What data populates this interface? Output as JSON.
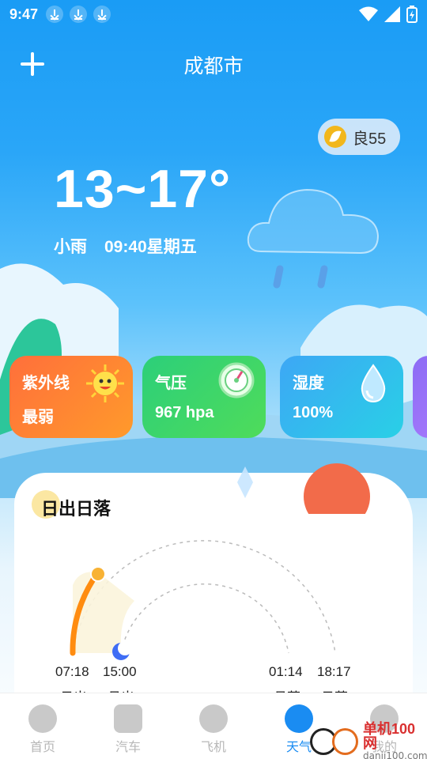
{
  "status_bar": {
    "time": "9:47",
    "download_icons": [
      "download-icon",
      "download-icon",
      "download-icon"
    ],
    "system_icons": [
      "wifi-icon",
      "signal-icon",
      "battery-charging-icon"
    ]
  },
  "header": {
    "add_icon": "plus-icon",
    "city": "成都市"
  },
  "air_quality": {
    "icon": "leaf-icon",
    "label": "良55"
  },
  "weather": {
    "temperature_range": "13~17°",
    "condition": "小雨",
    "datetime": "09:40星期五",
    "icon": "rain-cloud-icon"
  },
  "cards": [
    {
      "title": "紫外线",
      "value": "最弱",
      "icon": "sun-face-icon",
      "color": "#ff7f35"
    },
    {
      "title": "气压",
      "value": "967 hpa",
      "icon": "gauge-icon",
      "color": "#3bd46a"
    },
    {
      "title": "湿度",
      "value": "100%",
      "icon": "water-drop-icon",
      "color": "#34bdee"
    }
  ],
  "sun_moon": {
    "title": "日出日落",
    "times": [
      "07:18",
      "15:00",
      "01:14",
      "18:17"
    ],
    "labels": [
      "日出",
      "月出",
      "月落",
      "日落"
    ],
    "sun_progress": 0.3
  },
  "nav": {
    "items": [
      {
        "label": "首页",
        "icon": "home-icon",
        "active": false
      },
      {
        "label": "汽车",
        "icon": "bus-icon",
        "active": false
      },
      {
        "label": "飞机",
        "icon": "airplane-icon",
        "active": false
      },
      {
        "label": "天气",
        "icon": "weather-icon",
        "active": true
      },
      {
        "label": "我的",
        "icon": "profile-icon",
        "active": false
      }
    ]
  },
  "watermark": {
    "text": "单机100网",
    "url": "danji100.com"
  },
  "colors": {
    "sky": "#2aa6f8",
    "accent": "#1a8cf2",
    "sun_arc": "#ff8c10"
  }
}
